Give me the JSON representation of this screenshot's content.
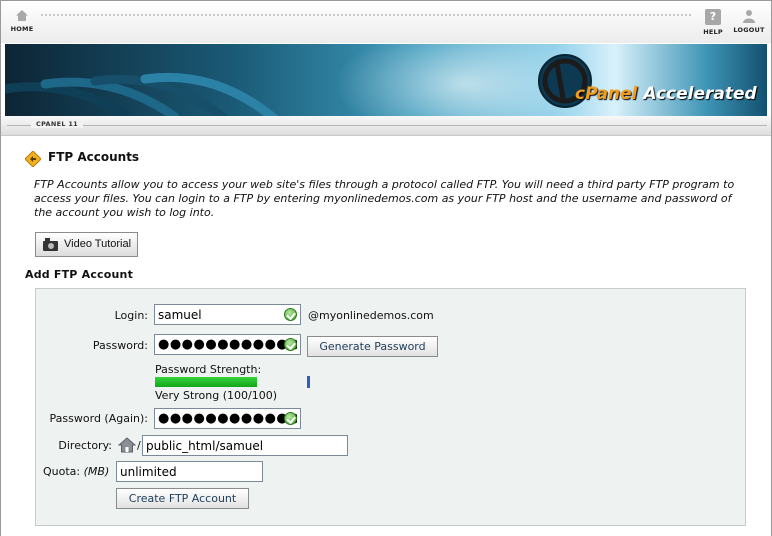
{
  "nav": {
    "home_label": "HOME",
    "help_label": "HELP",
    "logout_label": "LOGOUT"
  },
  "banner": {
    "logo_cp": "cPanel",
    "logo_word": "Accelerated"
  },
  "breadcrumb": "CPANEL 11",
  "page": {
    "title": "FTP Accounts",
    "intro": "FTP Accounts allow you to access your web site's files through a protocol called FTP. You will need a third party FTP program to access your files. You can login to a FTP by entering myonlinedemos.com as your FTP host and the username and password of the account you wish to log into.",
    "video_button": "Video Tutorial",
    "section_title": "Add FTP Account"
  },
  "form": {
    "login_label": "Login:",
    "login_value": "samuel",
    "domain_suffix": "@myonlinedemos.com",
    "password_label": "Password:",
    "password_value": "●●●●●●●●●●●●●",
    "generate_button": "Generate Password",
    "strength_label": "Password Strength:",
    "strength_text": "Very Strong (100/100)",
    "strength_fraction": 1.0,
    "password_again_label": "Password (Again):",
    "password_again_value": "●●●●●●●●●●●●●",
    "directory_label": "Directory:",
    "directory_slash": "/",
    "directory_value": "public_html/samuel",
    "quota_label": "Quota:",
    "quota_unit": "(MB)",
    "quota_value": "unlimited",
    "create_button": "Create FTP Account"
  },
  "colors": {
    "strength_green": "#13a51c",
    "ok_green": "#3f9d2a",
    "logo_orange": "#f29c1c"
  }
}
